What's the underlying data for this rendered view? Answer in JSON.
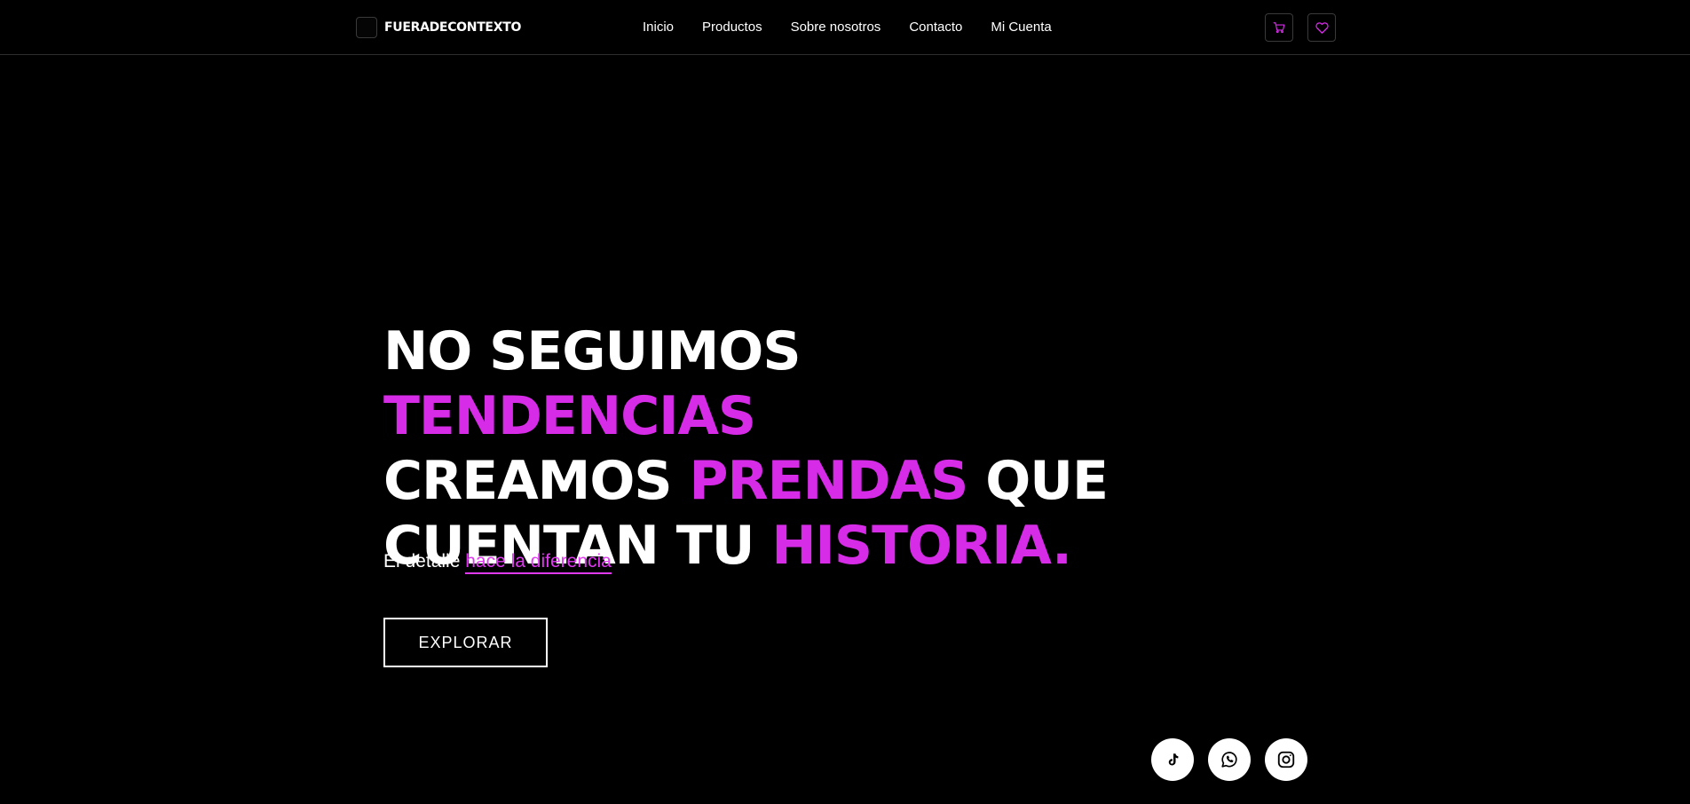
{
  "brand": {
    "name": "FUERADECONTEXTO"
  },
  "nav": {
    "items": [
      {
        "label": "Inicio"
      },
      {
        "label": "Productos"
      },
      {
        "label": "Sobre nosotros"
      },
      {
        "label": "Contacto"
      },
      {
        "label": "Mi Cuenta"
      }
    ]
  },
  "header_actions": {
    "cart_icon": "cart-icon",
    "wishlist_icon": "heart-icon"
  },
  "hero": {
    "line1_a": "NO SEGUIMOS ",
    "line1_b": "TENDENCIAS",
    "line2_a": "CREAMOS ",
    "line2_b": "PRENDAS",
    "line2_c": " QUE",
    "line3_a": "CUENTAN TU ",
    "line3_b": "HISTORIA.",
    "subtitle_a": "El detalle ",
    "subtitle_link": "hace la diferencia",
    "cta_label": "EXPLORAR"
  },
  "social": {
    "items": [
      "tiktok-icon",
      "whatsapp-icon",
      "instagram-icon"
    ]
  },
  "colors": {
    "accent": "#d62ce8",
    "background": "#000000",
    "text": "#ffffff"
  }
}
